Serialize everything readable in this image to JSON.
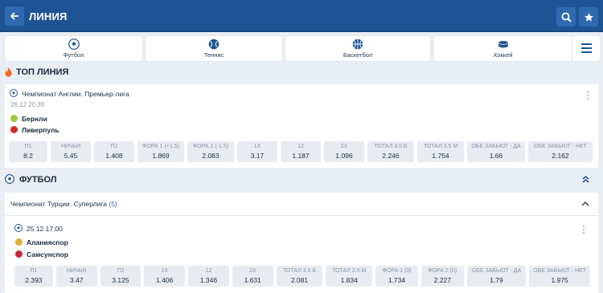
{
  "header": {
    "title": "ЛИНИЯ"
  },
  "sports_tabs": [
    {
      "label": "Футбол",
      "icon": "football-icon"
    },
    {
      "label": "Теннис",
      "icon": "tennis-icon"
    },
    {
      "label": "Баскетбол",
      "icon": "basketball-icon"
    },
    {
      "label": "Хоккей",
      "icon": "hockey-icon"
    }
  ],
  "top_line": {
    "title": "ТОП ЛИНИЯ",
    "event": {
      "league": "Чемпионат Англии. Премьер-лига",
      "datetime": "26.12 20:30",
      "team1": "Бернли",
      "team2": "Ливерпуль",
      "odds": [
        {
          "label": "П1",
          "value": "8.2"
        },
        {
          "label": "НИЧЬЯ",
          "value": "5.45"
        },
        {
          "label": "П2",
          "value": "1.408"
        },
        {
          "label": "ФОРА 1 (+1.5)",
          "value": "1.869"
        },
        {
          "label": "ФОРА 2 (-1.5)",
          "value": "2.083"
        },
        {
          "label": "1X",
          "value": "3.17"
        },
        {
          "label": "12",
          "value": "1.187"
        },
        {
          "label": "2X",
          "value": "1.096"
        },
        {
          "label": "ТОТАЛ 3.5 Б",
          "value": "2.246"
        },
        {
          "label": "ТОТАЛ 3.5 М",
          "value": "1.754"
        },
        {
          "label": "ОБЕ ЗАБЬЮТ - ДА",
          "value": "1.66"
        },
        {
          "label": "ОБЕ ЗАБЬЮТ - НЕТ",
          "value": "2.162"
        }
      ]
    }
  },
  "football": {
    "title": "ФУТБОЛ",
    "league": "Чемпионат Турции. Суперлига",
    "league_count": "(5)",
    "event": {
      "datetime": "25.12 17:00",
      "team1": "Аланияспор",
      "team2": "Самсунспор",
      "odds": [
        {
          "label": "П1",
          "value": "2.393"
        },
        {
          "label": "НИЧЬЯ",
          "value": "3.47"
        },
        {
          "label": "П2",
          "value": "3.125"
        },
        {
          "label": "1X",
          "value": "1.406"
        },
        {
          "label": "12",
          "value": "1.346"
        },
        {
          "label": "2X",
          "value": "1.631"
        },
        {
          "label": "ТОТАЛ 3.5 Б",
          "value": "2.081"
        },
        {
          "label": "ТОТАЛ 2.5 М",
          "value": "1.834"
        },
        {
          "label": "ФОРА 1 (0)",
          "value": "1.734"
        },
        {
          "label": "ФОРА 2 (0)",
          "value": "2.227"
        },
        {
          "label": "ОБЕ ЗАБЬЮТ - ДА",
          "value": "1.79"
        },
        {
          "label": "ОБЕ ЗАБЬЮТ - НЕТ",
          "value": "1.975"
        }
      ]
    }
  },
  "colors": {
    "header": "#1e5494",
    "accent": "#2f6ab0",
    "background": "#e9eef4",
    "fire": "#f06a21"
  }
}
